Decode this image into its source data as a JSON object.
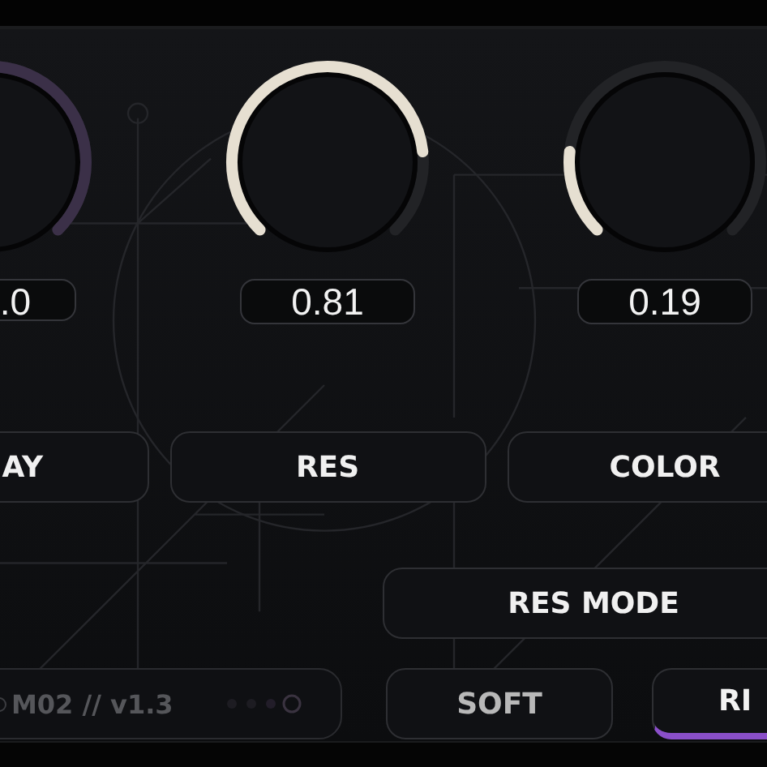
{
  "knobs": [
    {
      "value": ".0",
      "color": "#3b3048"
    },
    {
      "value": "0.81",
      "color": "#e6dfd1"
    },
    {
      "value": "0.19",
      "color": "#e6dfd1"
    }
  ],
  "buttons": [
    "AY",
    "RES",
    "COLOR"
  ],
  "res_mode": {
    "label": "RES MODE"
  },
  "version": {
    "label": "M02 // v1.3"
  },
  "modes": [
    {
      "label": "SOFT",
      "selected": false
    },
    {
      "label": "RI",
      "selected": true
    }
  ]
}
